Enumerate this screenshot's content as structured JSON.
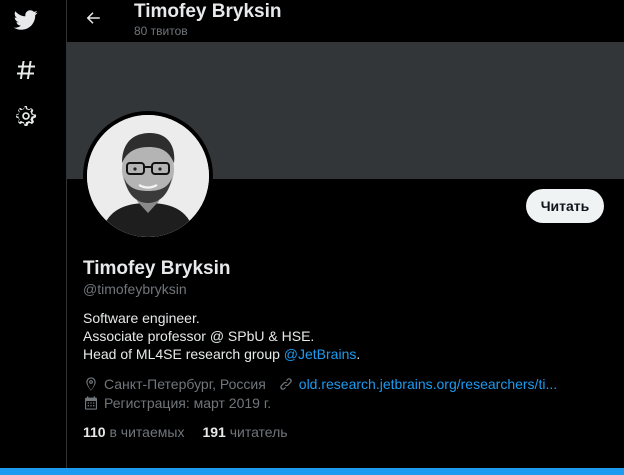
{
  "nav": {
    "items": [
      {
        "icon": "twitter-bird-icon"
      },
      {
        "icon": "hashtag-icon"
      },
      {
        "icon": "gear-icon"
      }
    ]
  },
  "header": {
    "title": "Timofey Bryksin",
    "tweet_count": "80 твитов"
  },
  "profile": {
    "follow_label": "Читать",
    "name": "Timofey Bryksin",
    "handle": "@timofeybryksin",
    "bio_line1": "Software engineer.",
    "bio_line2": "Associate professor @ SPbU & HSE.",
    "bio_line3_prefix": "Head of ML4SE research group ",
    "bio_line3_mention": "@JetBrains",
    "bio_line3_suffix": ".",
    "location": "Санкт-Петербург, Россия",
    "website": "old.research.jetbrains.org/researchers/ti...",
    "joined": "Регистрация: март 2019 г.",
    "following_count": "110",
    "following_label": "в читаемых",
    "followers_count": "191",
    "followers_label": "читатель"
  },
  "colors": {
    "accent": "#1d9bf0",
    "background": "#000000",
    "banner": "#333639",
    "muted_text": "#71767b"
  }
}
